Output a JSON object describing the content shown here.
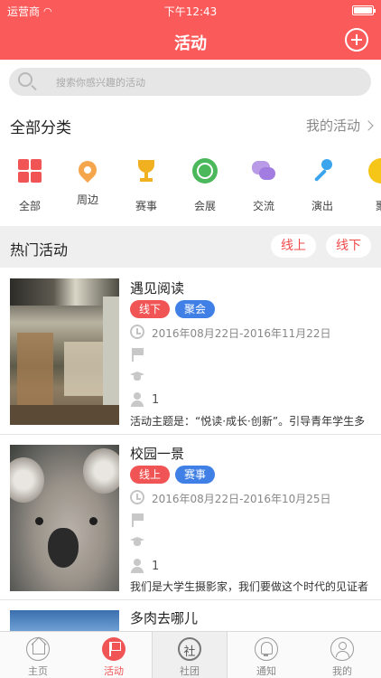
{
  "status_bar": {
    "carrier": "运营商",
    "time": "下午12:43"
  },
  "nav": {
    "title": "活动"
  },
  "search": {
    "placeholder": "搜索你感兴趣的活动"
  },
  "categories_header": {
    "title": "全部分类",
    "my_activities": "我的活动"
  },
  "categories": [
    {
      "label": "全部",
      "icon": "grid-icon"
    },
    {
      "label": "周边",
      "icon": "location-pin-icon"
    },
    {
      "label": "赛事",
      "icon": "trophy-icon"
    },
    {
      "label": "会展",
      "icon": "globe-icon"
    },
    {
      "label": "交流",
      "icon": "chat-bubbles-icon"
    },
    {
      "label": "演出",
      "icon": "microphone-icon"
    },
    {
      "label": "聚",
      "icon": "party-icon"
    }
  ],
  "hot": {
    "title": "热门活动",
    "filter_online": "线上",
    "filter_offline": "线下"
  },
  "activities": [
    {
      "title": "遇见阅读",
      "tags": [
        "线下",
        "聚会"
      ],
      "date": "2016年08月22日-2016年11月22日",
      "count": "1",
      "description": "活动主题是：“悦读·成长·创新”。引导青年学生多"
    },
    {
      "title": "校园一景",
      "tags": [
        "线上",
        "赛事"
      ],
      "date": "2016年08月22日-2016年10月25日",
      "count": "1",
      "description": "我们是大学生摄影家，我们要做这个时代的见证者"
    },
    {
      "title": "多肉去哪儿"
    }
  ],
  "tabbar": {
    "home": "主页",
    "activities": "活动",
    "club_glyph": "社",
    "club": "社团",
    "notice": "通知",
    "mine": "我的"
  },
  "colors": {
    "brand": "#fb5a5a",
    "tag_red": "#f05454",
    "tag_blue": "#3f7fe6"
  }
}
